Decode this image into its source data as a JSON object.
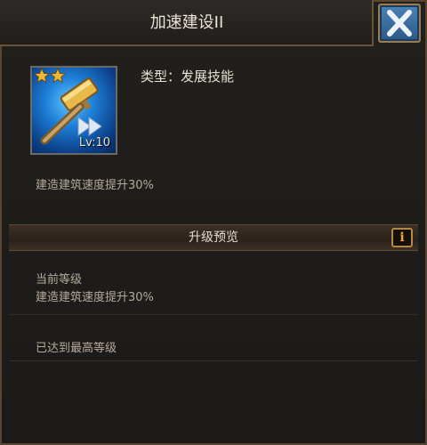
{
  "dialog": {
    "title": "加速建设II",
    "close_icon": "close-x-icon"
  },
  "skill": {
    "icon": "hammer-speedup-icon",
    "level_label": "Lv:10",
    "stars_filled": 2,
    "type_label": "类型：发展技能",
    "description": "建造建筑速度提升30%"
  },
  "upgrade": {
    "header_label": "升级预览",
    "info_icon": "info-icon",
    "current_level_label": "当前等级",
    "current_effect": "建造建筑速度提升30%",
    "max_level_message": "已达到最高等级"
  },
  "colors": {
    "accent_gold": "#b38a44",
    "close_blue": "#2a5787",
    "info_orange": "#f2a52a"
  }
}
